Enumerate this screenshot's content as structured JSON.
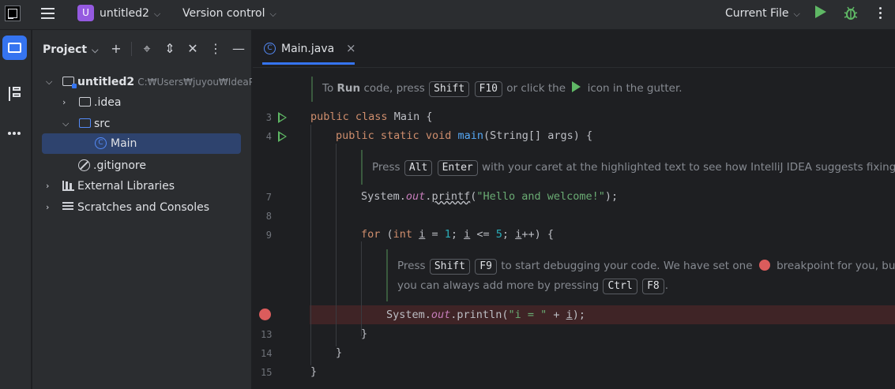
{
  "titlebar": {
    "project_badge": "U",
    "project_name": "untitled2",
    "version_control": "Version control",
    "run_config": "Current File"
  },
  "toolstrip": {
    "items": [
      "project-tool",
      "structure-tool",
      "more-tools"
    ]
  },
  "project_panel": {
    "title": "Project",
    "tree": [
      {
        "label": "untitled2",
        "path": "C:₩Users₩juyou₩IdeaPr",
        "expanded": true,
        "icon": "module-folder-icon"
      },
      {
        "label": ".idea",
        "expanded": false,
        "icon": "folder-icon"
      },
      {
        "label": "src",
        "expanded": true,
        "icon": "source-folder-icon"
      },
      {
        "label": "Main",
        "selected": true,
        "icon": "class-icon"
      },
      {
        "label": ".gitignore",
        "icon": "ignore-file-icon"
      },
      {
        "label": "External Libraries",
        "expanded": false,
        "icon": "library-icon"
      },
      {
        "label": "Scratches and Consoles",
        "expanded": false,
        "icon": "scratch-icon"
      }
    ]
  },
  "editor": {
    "tab": {
      "label": "Main.java",
      "icon_glyph": "C",
      "close": "×"
    },
    "line_numbers": {
      "l3": "3",
      "l4": "4",
      "l7": "7",
      "l8": "8",
      "l9": "9",
      "l13": "13",
      "l14": "14",
      "l15": "15"
    },
    "hint1": {
      "pre": "To",
      "bold": "Run",
      "mid": "code, press",
      "k1": "Shift",
      "k2": "F10",
      "post1": "or click the",
      "post2": "icon in the gutter."
    },
    "hint2": {
      "pre": "Press",
      "k1": "Alt",
      "k2": "Enter",
      "post": "with your caret at the highlighted text to see how IntelliJ IDEA suggests fixing it."
    },
    "hint3": {
      "pre": "Press",
      "k1": "Shift",
      "k2": "F9",
      "mid": "to start debugging your code. We have set one",
      "post": "breakpoint for you, but",
      "line2": "you can always add more by pressing",
      "k3": "Ctrl",
      "k4": "F8",
      "end": "."
    },
    "code": {
      "public": "public",
      "class": "class",
      "main_cls": "Main {",
      "static": "static",
      "void": "void",
      "main_fn": "main",
      "main_args": "(String[] args) {",
      "system": "System.",
      "out": "out",
      "dot": ".",
      "printf": "printf",
      "printf_open": "(",
      "hello": "\"Hello and welcome!\"",
      "close_stmt": ");",
      "for": "for",
      "paren_open": " (",
      "int": "int",
      "i": "i",
      "eq": " = ",
      "one": "1",
      "semi": "; ",
      "le": " <= ",
      "five": "5",
      "pp": "++) {",
      "println": ".println(",
      "i_str": "\"i = \"",
      "plus": " + ",
      "brace_close": "}"
    }
  },
  "colors": {
    "accent": "#3574f0",
    "run_green": "#5fb865",
    "breakpoint_red": "#db5c5c",
    "keyword": "#cf8e6d",
    "string": "#6aab73",
    "field": "#c77dbb",
    "function": "#56a8f5",
    "number": "#2aacb8"
  }
}
